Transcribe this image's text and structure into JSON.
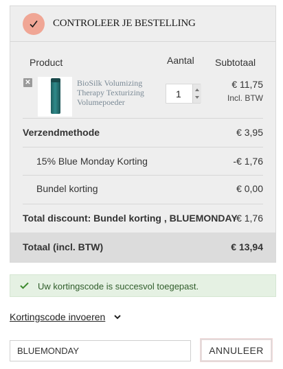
{
  "order": {
    "title": "CONTROLEER JE BESTELLING",
    "columns": {
      "product": "Product",
      "quantity": "Aantal",
      "subtotal": "Subtotaal"
    },
    "items": [
      {
        "name": "BioSilk Volumizing Therapy Texturizing Volumepoeder",
        "quantity": "1",
        "price": "€ 11,75",
        "vat_note": "Incl. BTW",
        "remove_icon": "close-icon"
      }
    ],
    "shipping": {
      "label": "Verzendmethode",
      "value": "€ 3,95"
    },
    "discounts": [
      {
        "label": "15% Blue Monday Korting",
        "value": "-€ 1,76"
      },
      {
        "label": "Bundel korting",
        "value": "€ 0,00"
      }
    ],
    "total_discount": {
      "label": "Total discount: Bundel korting , BLUEMONDAY",
      "value": "-€ 1,76"
    },
    "total": {
      "label": "Totaal (incl. BTW)",
      "value": "€ 13,94"
    }
  },
  "notice": {
    "text": "Uw kortingscode is succesvol toegepast.",
    "icon": "checkmark-icon"
  },
  "coupon": {
    "toggle_label": "Kortingscode invoeren",
    "value": "BLUEMONDAY",
    "cancel_label": "ANNULEER"
  },
  "colors": {
    "accent_badge": "#f0a695",
    "success_bg": "#e5f1e3",
    "success_check": "#3d8a2f",
    "panel_bg": "#eeeeee",
    "total_bar_bg": "#dcdcdc"
  }
}
